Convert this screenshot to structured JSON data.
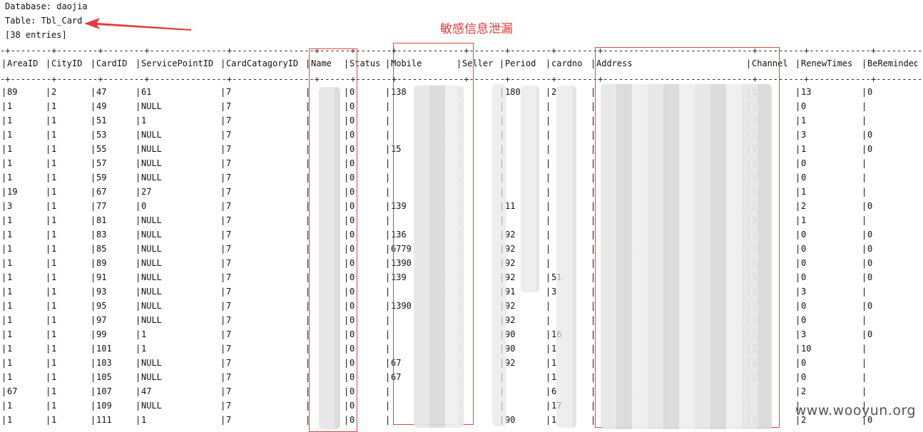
{
  "header": {
    "database_line": "Database: daojia",
    "table_line": "Table: Tbl_Card",
    "entries_line": "[38 entries]"
  },
  "annotation": {
    "label": "敏感信息泄漏",
    "color": "#e5393a"
  },
  "columns": [
    "AreaID",
    "CityID",
    "CardID",
    "ServicePointID",
    "CardCatagoryID",
    "Name",
    "Status",
    "Mobile",
    "Seller",
    "Period",
    "cardno",
    "Address",
    "Channel",
    "RenewTimes",
    "BeReminded"
  ],
  "rows": [
    [
      "89",
      "2",
      "47",
      "61",
      "7",
      "",
      "0",
      "138",
      "",
      "180",
      "2",
      "",
      "1",
      "13",
      "0"
    ],
    [
      "1",
      "1",
      "49",
      "NULL",
      "7",
      "",
      "0",
      "",
      "",
      "",
      "",
      "",
      "1",
      "0",
      ""
    ],
    [
      "1",
      "1",
      "51",
      "1",
      "7",
      "",
      "0",
      "",
      "",
      "",
      "",
      "",
      "1",
      "1",
      ""
    ],
    [
      "1",
      "1",
      "53",
      "NULL",
      "7",
      "",
      "0",
      "",
      "",
      "",
      "",
      "",
      "1",
      "3",
      "0"
    ],
    [
      "1",
      "1",
      "55",
      "NULL",
      "7",
      "",
      "0",
      "15",
      "",
      "",
      "",
      "",
      "1",
      "1",
      "0"
    ],
    [
      "1",
      "1",
      "57",
      "NULL",
      "7",
      "",
      "0",
      "",
      "",
      "",
      "",
      "",
      "1",
      "0",
      ""
    ],
    [
      "1",
      "1",
      "59",
      "NULL",
      "7",
      "",
      "0",
      "",
      "",
      "",
      "",
      "",
      "1",
      "0",
      ""
    ],
    [
      "19",
      "1",
      "67",
      "27",
      "7",
      "",
      "0",
      "",
      "",
      "",
      "",
      "",
      "1",
      "1",
      ""
    ],
    [
      "3",
      "1",
      "77",
      "0",
      "7",
      "",
      "0",
      "139",
      "",
      "11",
      "",
      "",
      "2",
      "2",
      "0"
    ],
    [
      "1",
      "1",
      "81",
      "NULL",
      "7",
      "",
      "0",
      "",
      "",
      "",
      "",
      "",
      "1",
      "1",
      ""
    ],
    [
      "1",
      "1",
      "83",
      "NULL",
      "7",
      "",
      "0",
      "136",
      "",
      "92",
      "",
      "",
      "1",
      "0",
      "0"
    ],
    [
      "1",
      "1",
      "85",
      "NULL",
      "7",
      "",
      "0",
      "6779",
      "",
      "92",
      "",
      "",
      "1",
      "0",
      "0"
    ],
    [
      "1",
      "1",
      "89",
      "NULL",
      "7",
      "",
      "0",
      "1390",
      "",
      "92",
      "",
      "",
      "1",
      "0",
      "0"
    ],
    [
      "1",
      "1",
      "91",
      "NULL",
      "7",
      "",
      "0",
      "139",
      "",
      "92",
      "51",
      "",
      "1",
      "0",
      "0"
    ],
    [
      "1",
      "1",
      "93",
      "NULL",
      "7",
      "",
      "0",
      "",
      "",
      "91",
      "3",
      "",
      "1",
      "3",
      ""
    ],
    [
      "1",
      "1",
      "95",
      "NULL",
      "7",
      "",
      "0",
      "1390",
      "",
      "92",
      "",
      "",
      "1",
      "0",
      "0"
    ],
    [
      "1",
      "1",
      "97",
      "NULL",
      "7",
      "",
      "0",
      "",
      "",
      "92",
      "",
      "",
      "1",
      "0",
      ""
    ],
    [
      "1",
      "1",
      "99",
      "1",
      "7",
      "",
      "0",
      "",
      "",
      "90",
      "16",
      "",
      "1",
      "3",
      "0"
    ],
    [
      "1",
      "1",
      "101",
      "1",
      "7",
      "",
      "0",
      "",
      "",
      "90",
      "1",
      "",
      "1",
      "10",
      ""
    ],
    [
      "1",
      "1",
      "103",
      "NULL",
      "7",
      "",
      "0",
      "67",
      "",
      "92",
      "1",
      "",
      "1",
      "0",
      ""
    ],
    [
      "1",
      "1",
      "105",
      "NULL",
      "7",
      "",
      "0",
      "67",
      "",
      "",
      "1",
      "",
      "1",
      "0",
      ""
    ],
    [
      "67",
      "1",
      "107",
      "47",
      "7",
      "",
      "0",
      "",
      "",
      "",
      "6",
      "",
      "",
      "2",
      ""
    ],
    [
      "1",
      "1",
      "109",
      "NULL",
      "7",
      "",
      "0",
      "",
      "",
      "",
      "17",
      "",
      "",
      "",
      ""
    ],
    [
      "1",
      "1",
      "111",
      "1",
      "7",
      "",
      "0",
      "",
      "",
      "90",
      "1",
      "",
      "1",
      "2",
      "0"
    ]
  ],
  "watermark": "www.wooyun.org"
}
